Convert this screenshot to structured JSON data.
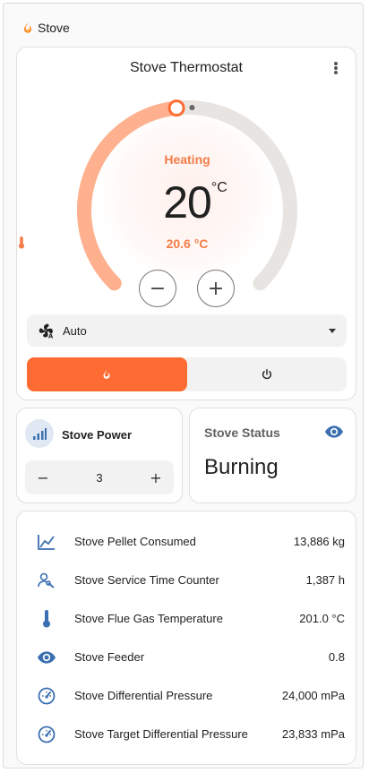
{
  "section": {
    "title": "Stove"
  },
  "thermostat": {
    "title": "Stove Thermostat",
    "mode": "Heating",
    "target": "20",
    "target_unit": "°C",
    "current": "20.6 °C",
    "minus": "−",
    "plus": "+",
    "fan_mode": "Auto",
    "colors": {
      "accent": "#ff6c33",
      "arc": "#ffb08e",
      "track": "#e8e4e1"
    }
  },
  "power": {
    "title": "Stove Power",
    "value": "3",
    "minus": "−",
    "plus": "+"
  },
  "status": {
    "title": "Stove Status",
    "value": "Burning"
  },
  "sensors": [
    {
      "icon": "chart-line-icon",
      "name": "Stove Pellet Consumed",
      "value": "13,886 kg"
    },
    {
      "icon": "account-wrench-icon",
      "name": "Stove Service Time Counter",
      "value": "1,387 h"
    },
    {
      "icon": "thermometer-icon",
      "name": "Stove Flue Gas Temperature",
      "value": "201.0 °C"
    },
    {
      "icon": "eye-icon",
      "name": "Stove Feeder",
      "value": "0.8"
    },
    {
      "icon": "gauge-icon",
      "name": "Stove Differential Pressure",
      "value": "24,000 mPa"
    },
    {
      "icon": "gauge-icon",
      "name": "Stove Target Differential Pressure",
      "value": "23,833 mPa"
    }
  ]
}
